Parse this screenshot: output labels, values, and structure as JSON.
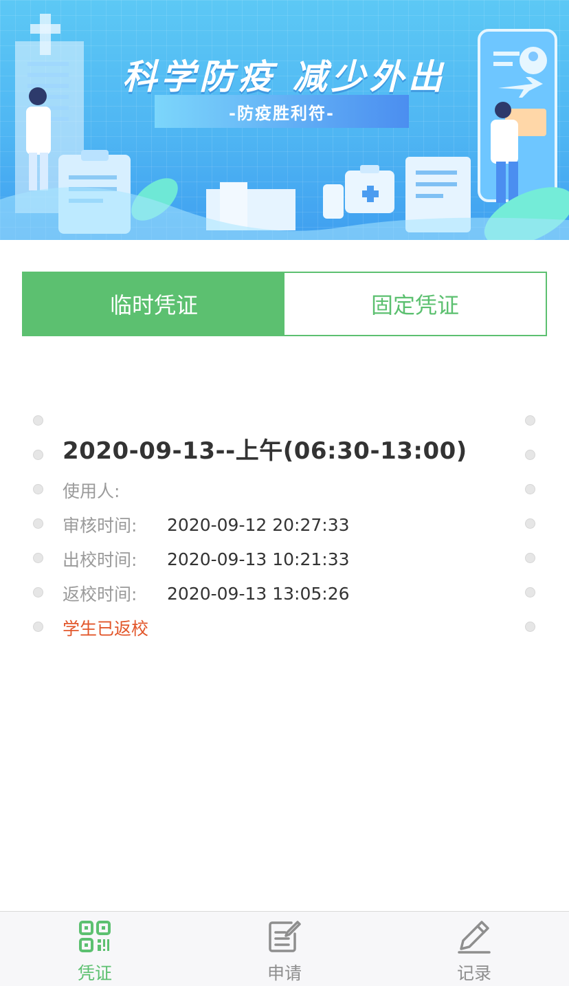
{
  "banner": {
    "title": "科学防疫  减少外出",
    "subtitle": "-防疫胜利符-"
  },
  "tabs": [
    {
      "label": "临时凭证",
      "active": true
    },
    {
      "label": "固定凭证",
      "active": false
    }
  ],
  "pass": {
    "title": "2020-09-13--上午(06:30-13:00)",
    "rows": [
      {
        "label": "使用人:",
        "value": ""
      },
      {
        "label": "审核时间:",
        "value": "2020-09-12 20:27:33"
      },
      {
        "label": "出校时间:",
        "value": "2020-09-13 10:21:33"
      },
      {
        "label": "返校时间:",
        "value": "2020-09-13 13:05:26"
      }
    ],
    "status": "学生已返校"
  },
  "bottom_nav": [
    {
      "label": "凭证",
      "icon": "qr-code-icon",
      "active": true
    },
    {
      "label": "申请",
      "icon": "edit-form-icon",
      "active": false
    },
    {
      "label": "记录",
      "icon": "pencil-icon",
      "active": false
    }
  ],
  "colors": {
    "accent": "#5cc070",
    "status": "#e2572b",
    "banner": "#4fb6f3"
  }
}
